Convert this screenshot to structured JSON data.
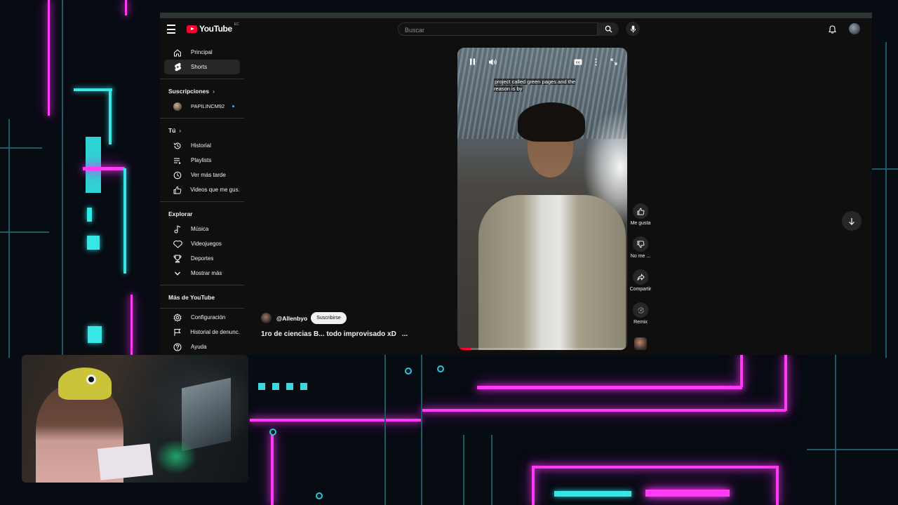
{
  "header": {
    "logo_text": "YouTube",
    "logo_region": "EC",
    "search_placeholder": "Buscar"
  },
  "sidebar": {
    "main": [
      {
        "label": "Principal",
        "icon": "home-icon"
      },
      {
        "label": "Shorts",
        "icon": "shorts-icon",
        "active": true
      }
    ],
    "subscriptions_title": "Suscripciones",
    "subscriptions": [
      {
        "label": "PAPILINCM92"
      }
    ],
    "you_title": "Tú",
    "you": [
      {
        "label": "Historial",
        "icon": "history-icon"
      },
      {
        "label": "Playlists",
        "icon": "playlists-icon"
      },
      {
        "label": "Ver más tarde",
        "icon": "watch-later-icon"
      },
      {
        "label": "Videos que me gus...",
        "icon": "liked-icon"
      }
    ],
    "explore_title": "Explorar",
    "explore": [
      {
        "label": "Música",
        "icon": "music-icon"
      },
      {
        "label": "Videojuegos",
        "icon": "gaming-icon"
      },
      {
        "label": "Deportes",
        "icon": "trophy-icon"
      },
      {
        "label": "Mostrar más",
        "icon": "chevron-down-icon"
      }
    ],
    "more_title": "Más de YouTube",
    "more": [
      {
        "label": "Configuración",
        "icon": "gear-icon"
      },
      {
        "label": "Historial de denunc...",
        "icon": "flag-icon"
      },
      {
        "label": "Ayuda",
        "icon": "help-icon"
      }
    ]
  },
  "short": {
    "caption": "project called green pages and the reason is by",
    "channel": "@Allenbyo",
    "subscribe_label": "Suscribirse",
    "title": "1ro de ciencias B... todo improvisado xD",
    "more_label": "...",
    "progress": 0.08,
    "actions": [
      {
        "label": "Me gusta",
        "icon": "thumb-up-icon"
      },
      {
        "label": "No me ...",
        "icon": "thumb-down-icon"
      },
      {
        "label": "Compartir",
        "icon": "share-icon"
      },
      {
        "label": "Remix",
        "icon": "remix-icon"
      }
    ]
  },
  "colors": {
    "brand": "#ff0033",
    "accent_magenta": "#ff3bf5",
    "accent_cyan": "#39e6e6"
  }
}
